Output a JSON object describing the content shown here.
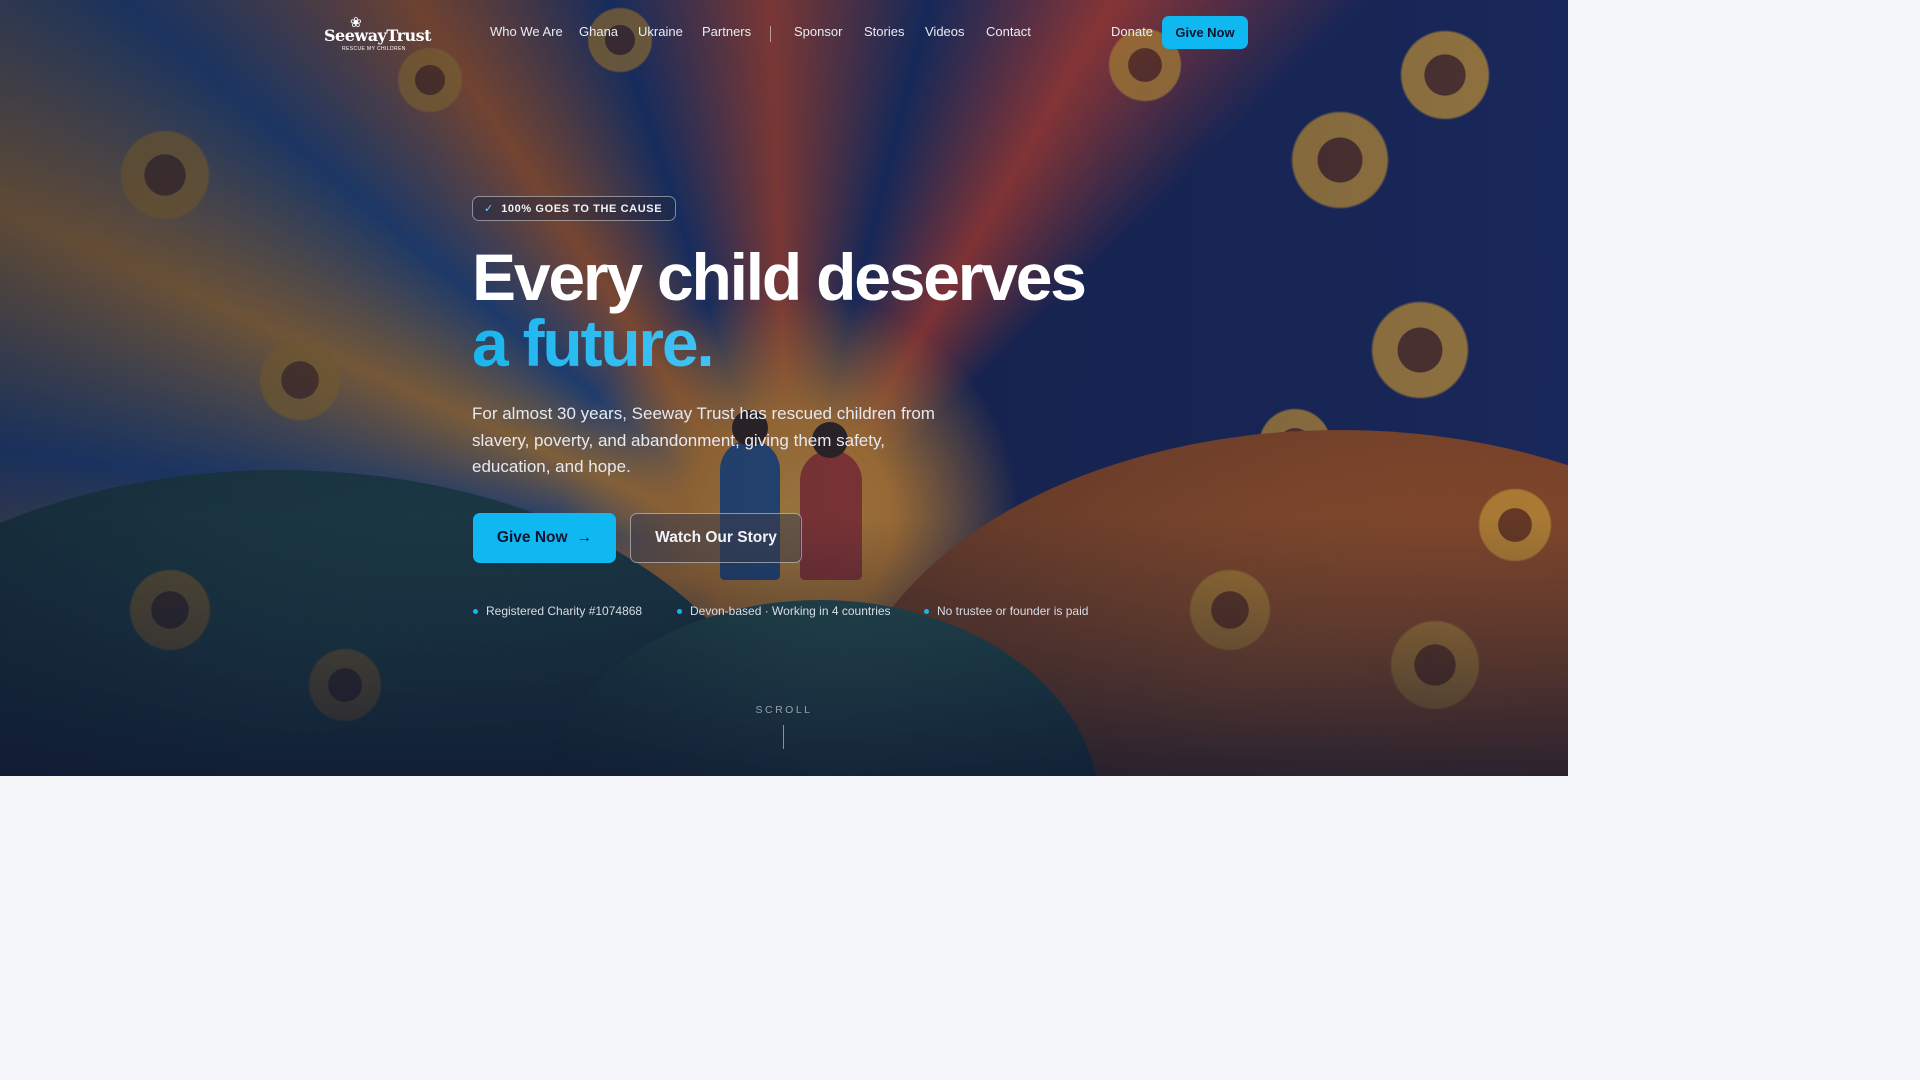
{
  "brand": {
    "name": "SeewayTrust",
    "tagline": "RESCUE MY CHILDREN"
  },
  "nav": {
    "links": [
      "Who We Are",
      "Ghana",
      "Ukraine",
      "Partners",
      "Sponsor",
      "Stories",
      "Videos",
      "Contact"
    ],
    "donate_label": "Donate",
    "give_now_label": "Give Now"
  },
  "hero": {
    "badge": "100% GOES TO THE CAUSE",
    "headline_line1": "Every child deserves",
    "headline_line2": "a future.",
    "lead": "For almost 30 years, Seeway Trust has rescued children from slavery, poverty, and abandonment, giving them safety, education, and hope.",
    "primary_cta": "Give Now",
    "secondary_cta": "Watch Our Story",
    "trust_items": [
      "Registered Charity #1074868",
      "Devon-based · Working in 4 countries",
      "No trustee or founder is paid"
    ],
    "scroll_label": "SCROLL"
  },
  "colors": {
    "accent": "#10b8f2",
    "headline_gradient_start": "#19b6ee",
    "headline_gradient_end": "#7fd6ff",
    "dark_text": "#0b1530",
    "below_fold_bg": "#f6f7fa"
  },
  "icons": {
    "badge": "check-icon",
    "primary_cta": "arrow-right-icon"
  }
}
